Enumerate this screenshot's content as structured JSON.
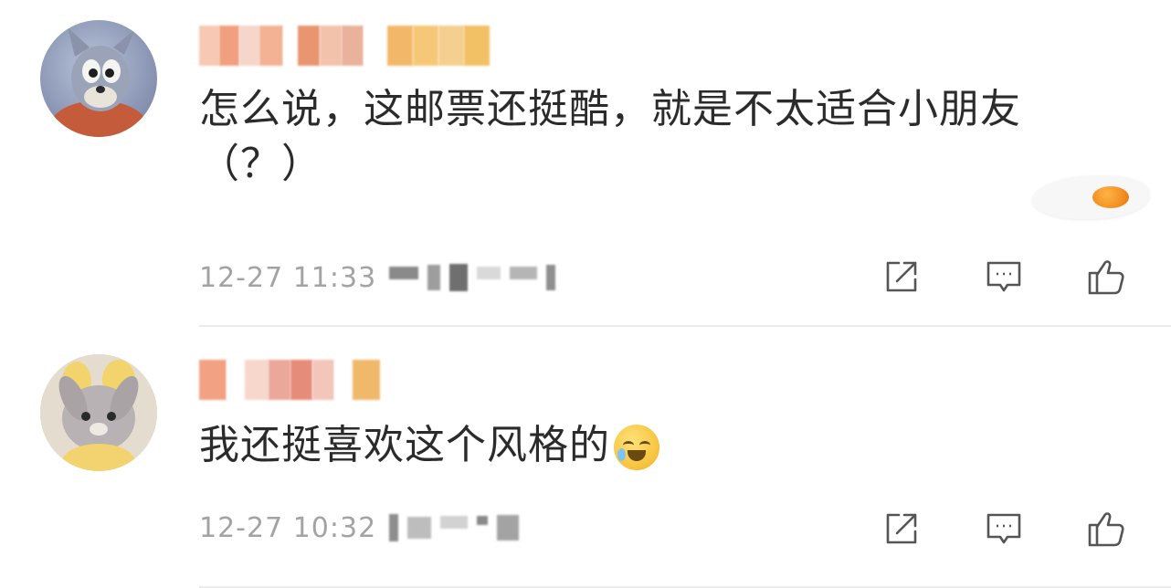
{
  "comments": [
    {
      "text": "怎么说，这邮票还挺酷，就是不太适合小朋友（？）",
      "timestamp": "12-27 11:33",
      "avatar_icon": "cartoon-cat-avatar-icon",
      "sticker_icon": "fried-egg-sticker-icon",
      "actions": [
        "share-icon",
        "comment-icon",
        "like-icon"
      ]
    },
    {
      "text": "我还挺喜欢这个风格的",
      "emoji_icon": "laughing-crying-emoji-icon",
      "timestamp": "12-27 10:32",
      "avatar_icon": "plush-bunny-avatar-icon",
      "actions": [
        "share-icon",
        "comment-icon",
        "like-icon"
      ]
    }
  ],
  "colors": {
    "text": "#2b2b2b",
    "meta": "#a3a3a3",
    "icon": "#555555",
    "divider": "#ececec"
  }
}
